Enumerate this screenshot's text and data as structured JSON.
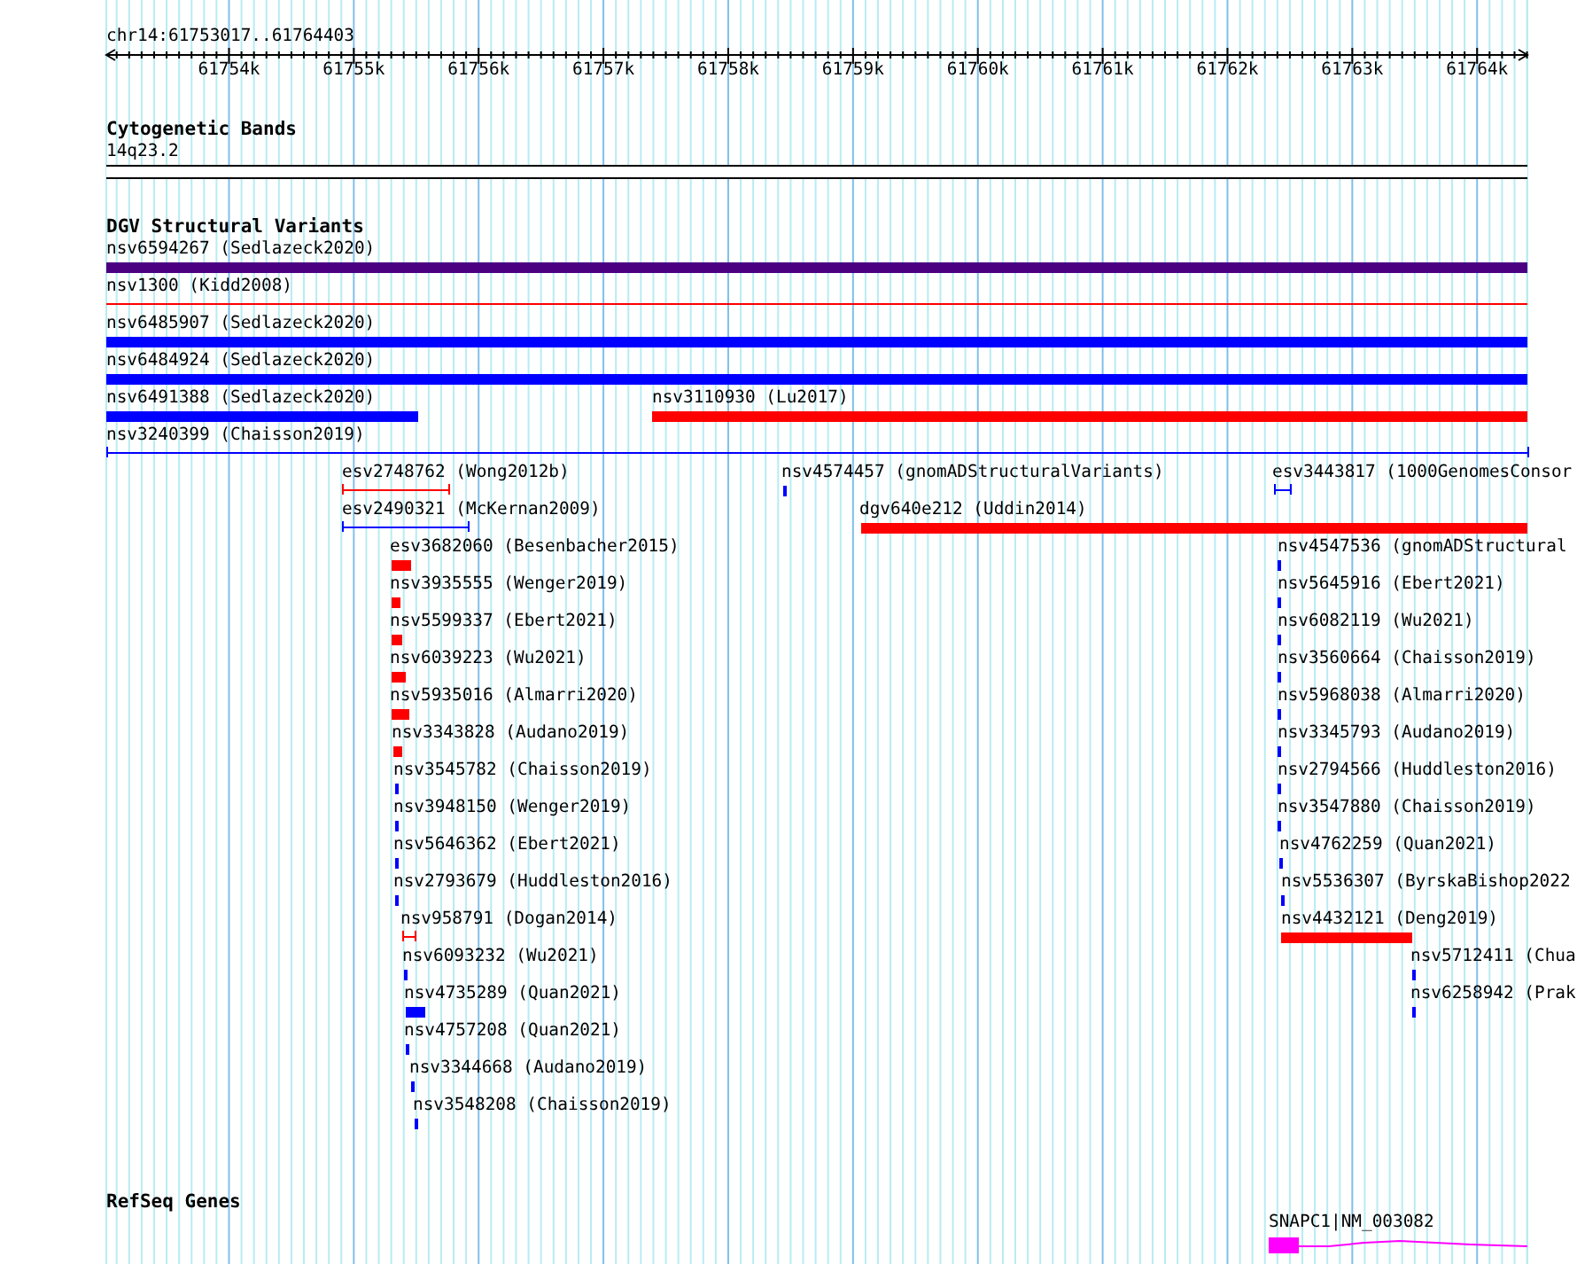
{
  "locus": "chr14:61753017..61764403",
  "ruler_labels": [
    "61754k",
    "61755k",
    "61756k",
    "61757k",
    "61758k",
    "61759k",
    "61760k",
    "61761k",
    "61762k",
    "61763k",
    "61764k"
  ],
  "tracks": [
    {
      "kind": "cytoband",
      "title": "Cytogenetic Bands",
      "features": [
        {
          "label": "14q23.2"
        }
      ]
    },
    {
      "kind": "variants",
      "title": "DGV Structural Variants",
      "features": [
        {
          "label": "nsv6594267 (Sedlazeck2020)",
          "kind": "bar",
          "color": "#4b0082"
        },
        {
          "label": "nsv1300 (Kidd2008)",
          "kind": "line",
          "color": "#ff0000"
        },
        {
          "label": "nsv6485907 (Sedlazeck2020)",
          "kind": "bar",
          "color": "#0000ff"
        },
        {
          "label": "nsv6484924 (Sedlazeck2020)",
          "kind": "bar",
          "color": "#0000ff"
        },
        {
          "label": "nsv6491388 (Sedlazeck2020)",
          "kind": "bar",
          "color": "#0000ff"
        },
        {
          "label": "nsv3110930 (Lu2017)",
          "kind": "bar",
          "color": "#ff0000"
        },
        {
          "label": "nsv3240399 (Chaisson2019)",
          "kind": "span",
          "color": "#0000ff"
        },
        {
          "label": "esv2748762 (Wong2012b)",
          "kind": "span",
          "color": "#ff0000"
        },
        {
          "label": "nsv4574457 (gnomADStructuralVariants)",
          "kind": "bar",
          "color": "#0000ff"
        },
        {
          "label": "esv3443817 (1000GenomesConsor",
          "kind": "span",
          "color": "#0000ff"
        },
        {
          "label": "esv2490321 (McKernan2009)",
          "kind": "span",
          "color": "#0000ff"
        },
        {
          "label": "dgv640e212 (Uddin2014)",
          "kind": "bar",
          "color": "#ff0000"
        },
        {
          "label": "esv3682060 (Besenbacher2015)",
          "kind": "bar",
          "color": "#ff0000"
        },
        {
          "label": "nsv4547536 (gnomADStructural",
          "kind": "bar",
          "color": "#0000ff"
        },
        {
          "label": "nsv3935555 (Wenger2019)",
          "kind": "bar",
          "color": "#ff0000"
        },
        {
          "label": "nsv5645916 (Ebert2021)",
          "kind": "bar",
          "color": "#0000ff"
        },
        {
          "label": "nsv5599337 (Ebert2021)",
          "kind": "bar",
          "color": "#ff0000"
        },
        {
          "label": "nsv6082119 (Wu2021)",
          "kind": "bar",
          "color": "#0000ff"
        },
        {
          "label": "nsv6039223 (Wu2021)",
          "kind": "bar",
          "color": "#ff0000"
        },
        {
          "label": "nsv3560664 (Chaisson2019)",
          "kind": "bar",
          "color": "#0000ff"
        },
        {
          "label": "nsv5935016 (Almarri2020)",
          "kind": "bar",
          "color": "#ff0000"
        },
        {
          "label": "nsv5968038 (Almarri2020)",
          "kind": "bar",
          "color": "#0000ff"
        },
        {
          "label": "nsv3343828 (Audano2019)",
          "kind": "bar",
          "color": "#ff0000"
        },
        {
          "label": "nsv3345793 (Audano2019)",
          "kind": "bar",
          "color": "#0000ff"
        },
        {
          "label": "nsv3545782 (Chaisson2019)",
          "kind": "bar",
          "color": "#0000ff"
        },
        {
          "label": "nsv2794566 (Huddleston2016)",
          "kind": "bar",
          "color": "#0000ff"
        },
        {
          "label": "nsv3948150 (Wenger2019)",
          "kind": "bar",
          "color": "#0000ff"
        },
        {
          "label": "nsv3547880 (Chaisson2019)",
          "kind": "bar",
          "color": "#0000ff"
        },
        {
          "label": "nsv5646362 (Ebert2021)",
          "kind": "bar",
          "color": "#0000ff"
        },
        {
          "label": "nsv4762259 (Quan2021)",
          "kind": "bar",
          "color": "#0000ff"
        },
        {
          "label": "nsv2793679 (Huddleston2016)",
          "kind": "bar",
          "color": "#0000ff"
        },
        {
          "label": "nsv5536307 (ByrskaBishop2022",
          "kind": "bar",
          "color": "#0000ff"
        },
        {
          "label": "nsv958791 (Dogan2014)",
          "kind": "span",
          "color": "#ff0000"
        },
        {
          "label": "nsv4432121 (Deng2019)",
          "kind": "bar",
          "color": "#ff0000"
        },
        {
          "label": "nsv6093232 (Wu2021)",
          "kind": "bar",
          "color": "#0000ff"
        },
        {
          "label": "nsv5712411 (Chua",
          "kind": "bar",
          "color": "#0000ff"
        },
        {
          "label": "nsv4735289 (Quan2021)",
          "kind": "bar",
          "color": "#0000ff"
        },
        {
          "label": "nsv6258942 (Prak",
          "kind": "bar",
          "color": "#0000ff"
        },
        {
          "label": "nsv4757208 (Quan2021)",
          "kind": "bar",
          "color": "#0000ff"
        },
        {
          "label": "nsv3344668 (Audano2019)",
          "kind": "bar",
          "color": "#0000ff"
        },
        {
          "label": "nsv3548208 (Chaisson2019)",
          "kind": "bar",
          "color": "#0000ff"
        }
      ]
    },
    {
      "kind": "genes",
      "title": "RefSeq Genes",
      "features": [
        {
          "label": "SNAPC1|NM_003082",
          "color": "#ff00ff"
        }
      ]
    }
  ]
}
